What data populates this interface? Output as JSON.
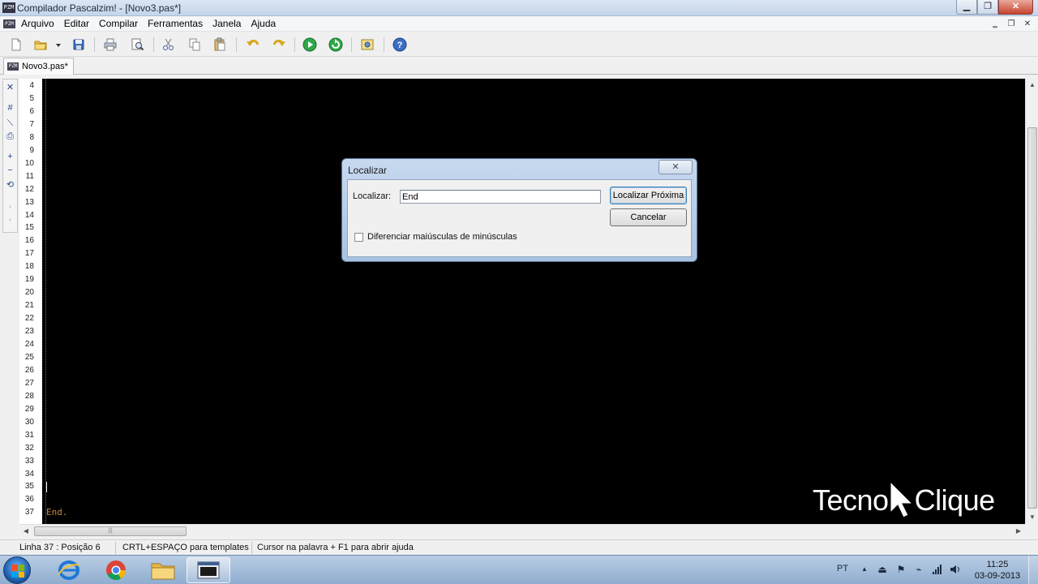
{
  "window": {
    "title": "Compilador Pascalzim! - [Novo3.pas*]",
    "app_icon_text": "PZM",
    "minimize": "▁",
    "maximize": "❐",
    "close": "✕"
  },
  "menu": {
    "items": [
      "Arquivo",
      "Editar",
      "Compilar",
      "Ferramentas",
      "Janela",
      "Ajuda"
    ],
    "mdi_minimize": "‗",
    "mdi_restore": "❐",
    "mdi_close": "✕"
  },
  "toolbar": {
    "buttons": [
      "new-file",
      "open-file",
      "open-dropdown",
      "save",
      "print",
      "print-preview",
      "cut",
      "copy",
      "paste",
      "undo",
      "redo",
      "run",
      "run-step",
      "tools",
      "help"
    ]
  },
  "tabs": [
    {
      "label": "Novo3.pas*",
      "active": true
    }
  ],
  "side_tools": [
    "close",
    "hash",
    "ruler",
    "print-tool",
    "plus",
    "minus",
    "link"
  ],
  "editor": {
    "line_numbers": [
      "4",
      "5",
      "6",
      "7",
      "8",
      "9",
      "10",
      "11",
      "12",
      "13",
      "14",
      "15",
      "16",
      "17",
      "18",
      "19",
      "20",
      "21",
      "22",
      "23",
      "24",
      "25",
      "26",
      "27",
      "28",
      "29",
      "30",
      "31",
      "32",
      "33",
      "34",
      "35",
      "36",
      "37"
    ],
    "last_line_code": "End.",
    "background": "#000000",
    "code_color": "#c98a3a"
  },
  "dialog": {
    "title": "Localizar",
    "close": "✕",
    "find_label": "Localizar:",
    "find_value": "End",
    "find_next_button": "Localizar Próxima",
    "cancel_button": "Cancelar",
    "match_case_label": "Diferenciar maiúsculas de minúsculas",
    "match_case_checked": false
  },
  "statusbar": {
    "position": "Linha 37 : Posição 6",
    "hint_templates": "CRTL+ESPAÇO para templates",
    "hint_help": "Cursor na palavra + F1 para abrir ajuda"
  },
  "watermark": {
    "left": "Tecno",
    "right": "Clique"
  },
  "taskbar": {
    "apps": [
      "internet-explorer",
      "chrome",
      "file-explorer",
      "pascalzim"
    ],
    "language": "PT",
    "time": "11:25",
    "date": "03-09-2013"
  }
}
